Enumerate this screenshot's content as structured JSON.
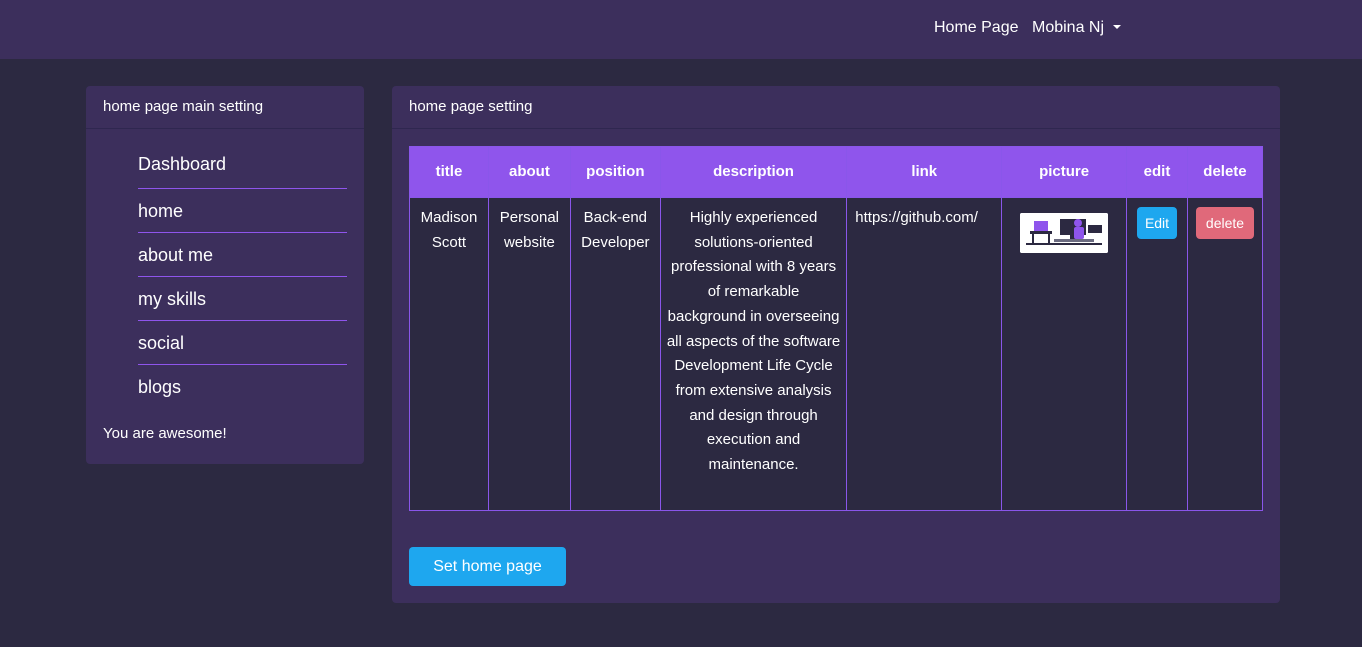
{
  "navbar": {
    "home_label": "Home Page",
    "user_label": "Mobina Nj"
  },
  "sidebar": {
    "header": "home page main setting",
    "items": [
      {
        "label": "Dashboard"
      },
      {
        "label": "home"
      },
      {
        "label": "about me"
      },
      {
        "label": "my skills"
      },
      {
        "label": "social"
      },
      {
        "label": "blogs"
      }
    ],
    "footer": "You are awesome!"
  },
  "main": {
    "header": "home page setting",
    "table": {
      "headers": [
        "title",
        "about",
        "position",
        "description",
        "link",
        "picture",
        "edit",
        "delete"
      ],
      "rows": [
        {
          "title": "Madison Scott",
          "about": "Personal website",
          "position": "Back-end Developer",
          "description": "Highly experienced solutions-oriented professional with 8 years of remarkable background in overseeing all aspects of the software Development Life Cycle from extensive analysis and design through execution and maintenance.",
          "link": "https://github.com/",
          "picture_icon": "developer-desk-illustration",
          "edit_label": "Edit",
          "delete_label": "delete"
        }
      ]
    },
    "submit_label": "Set home page"
  },
  "colors": {
    "background": "#2c2941",
    "card": "#3c2f5c",
    "accent": "#8f55ec",
    "primary_button": "#1ea7ef",
    "danger_button": "#e0697a"
  }
}
